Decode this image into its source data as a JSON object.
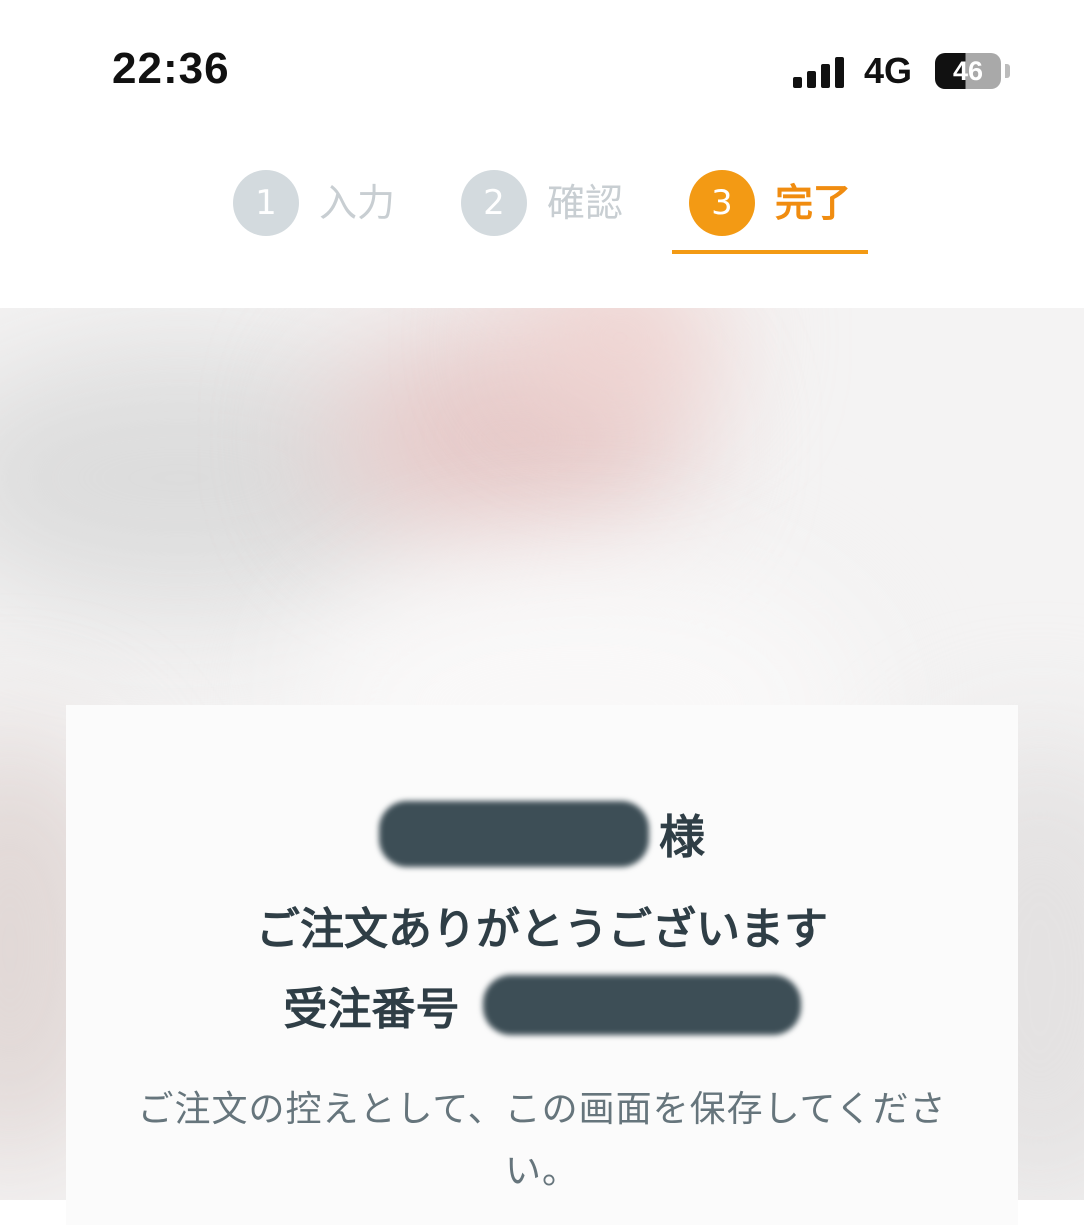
{
  "status_bar": {
    "time": "22:36",
    "network": "4G",
    "battery_level": "46"
  },
  "stepper": {
    "steps": [
      {
        "number": "1",
        "label": "入力",
        "state": "inactive"
      },
      {
        "number": "2",
        "label": "確認",
        "state": "inactive"
      },
      {
        "number": "3",
        "label": "完了",
        "state": "active"
      }
    ],
    "active_color": "#f39a14",
    "inactive_color": "#d3dade"
  },
  "confirmation": {
    "customer_suffix": "様",
    "thanks": "ご注文ありがとうございます",
    "order_number_label": "受注番号",
    "save_note": "ご注文の控えとして、この画面を保存してください。"
  },
  "colors": {
    "text_dark": "#2f3e46",
    "text_muted": "#66757c",
    "redaction": "#3d4e56"
  }
}
